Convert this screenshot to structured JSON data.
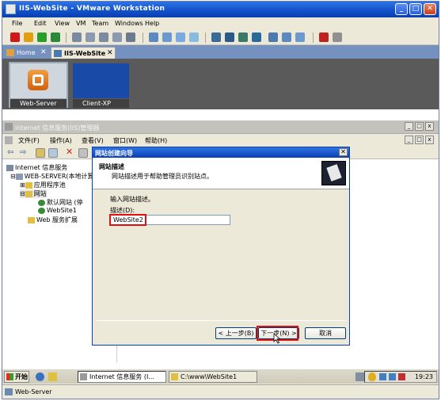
{
  "window": {
    "title": "IIS-WebSite - VMware Workstation"
  },
  "menu": [
    "File",
    "Edit",
    "View",
    "VM",
    "Team",
    "Windows",
    "Help"
  ],
  "tabs": [
    {
      "label": "Home"
    },
    {
      "label": "IIS-WebSite"
    }
  ],
  "thumbnails": [
    {
      "label": "Web-Server"
    },
    {
      "label": "Client-XP"
    }
  ],
  "iis": {
    "title": "Internet 信息服务(IIS)管理器",
    "menu": [
      "文件(F)",
      "操作(A)",
      "查看(V)",
      "窗口(W)",
      "帮助(H)"
    ],
    "tree": [
      "Internet 信息服务",
      "WEB-SERVER(本地计算",
      "应用程序池",
      "网站",
      "默认网站 (停",
      "WebSite1",
      "Web 服务扩展"
    ]
  },
  "dialog": {
    "title": "网站创建向导",
    "heading": "网站描述",
    "subheading": "网站描述用于帮助管理员识别站点。",
    "prompt": "输入网站描述。",
    "field_label": "描述(D):",
    "field_value": "WebSite2",
    "back": "< 上一步(B)",
    "next": "下一步(N) >",
    "cancel": "取消"
  },
  "taskbar": {
    "start": "开始",
    "tasks": [
      "Internet 信息服务 (I...",
      "C:\\www\\WebSite1"
    ],
    "clock": "19:23"
  },
  "status": "Web-Server"
}
